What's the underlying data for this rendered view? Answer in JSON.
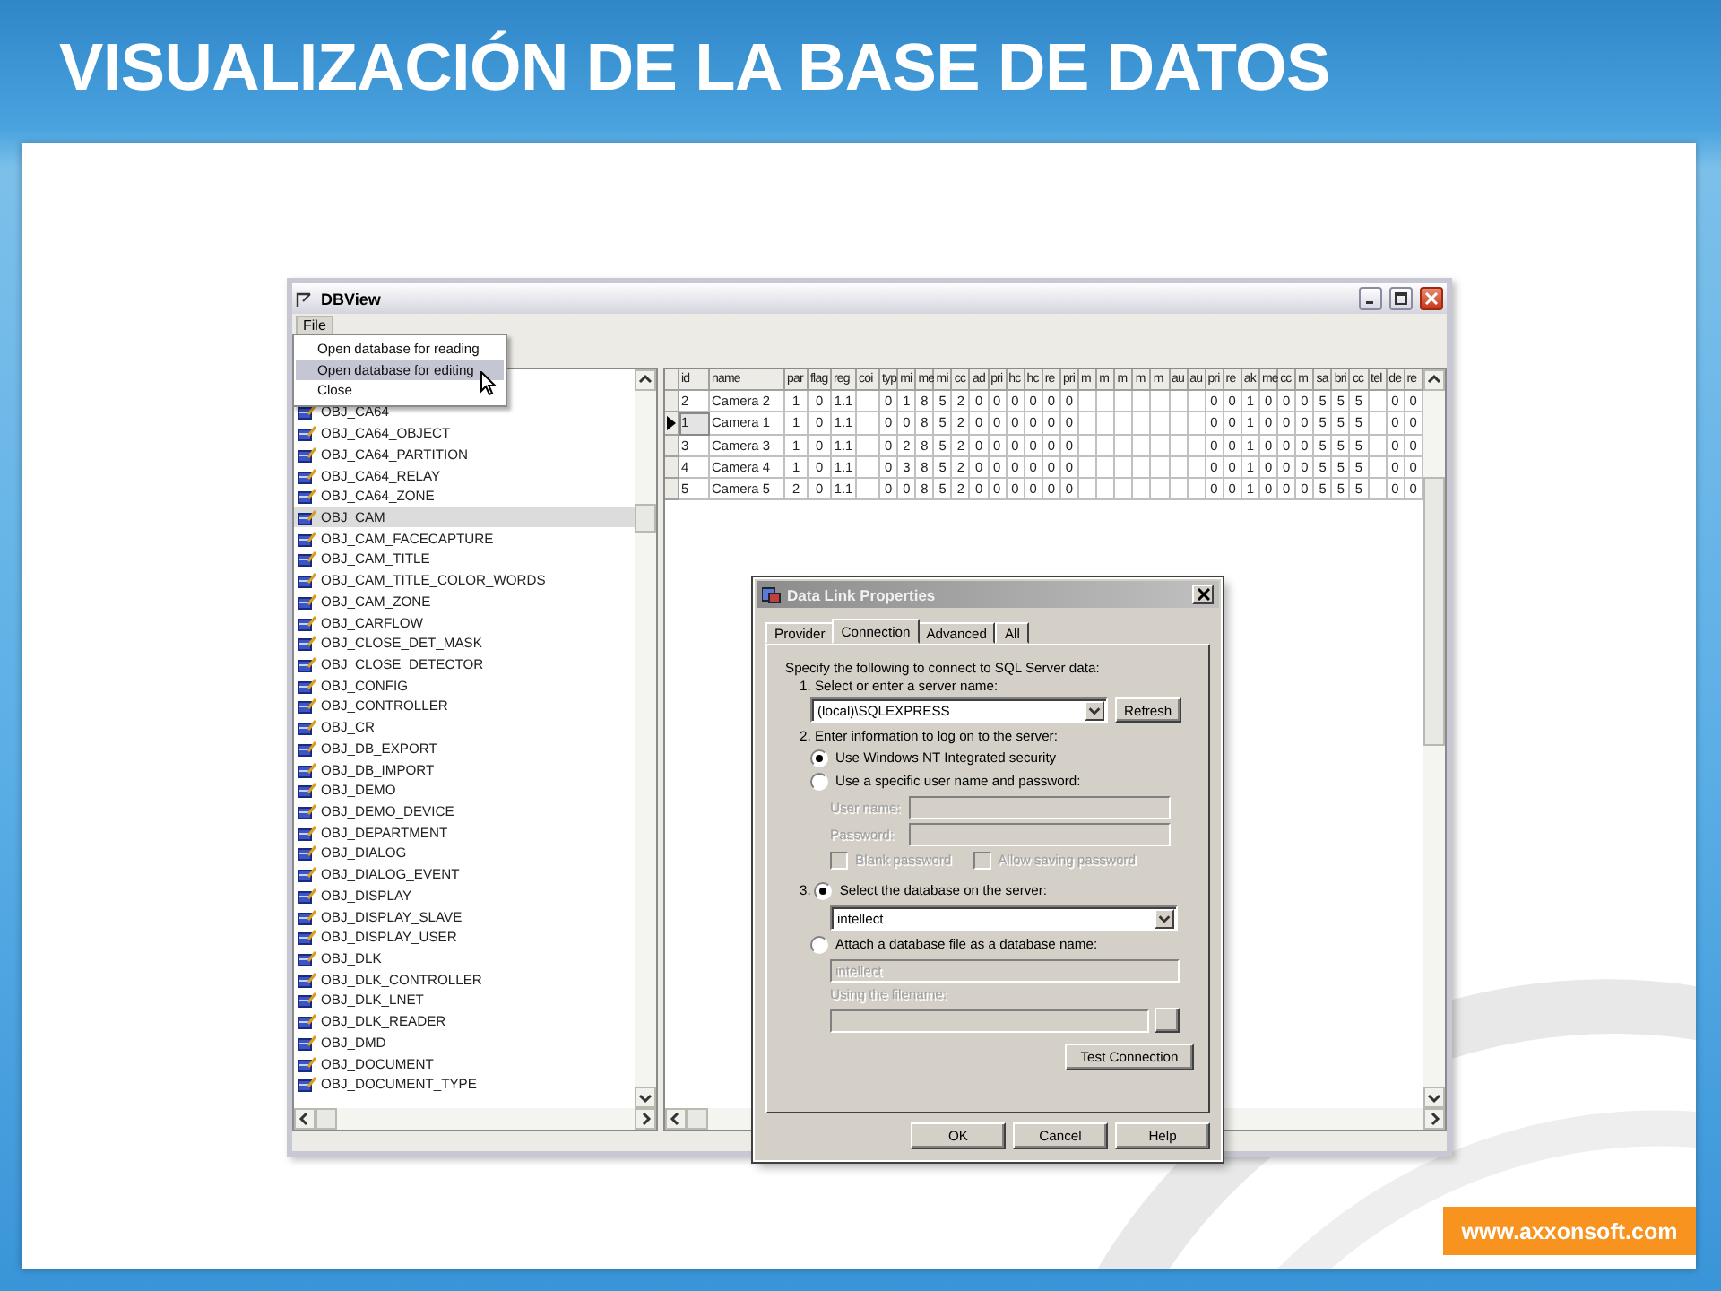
{
  "slide": {
    "title": "VISUALIZACIÓN DE LA BASE DE DATOS",
    "footer_link": "www.axxonsoft.com"
  },
  "dbview": {
    "title": "DBView",
    "menu": [
      "File"
    ],
    "file_menu": [
      {
        "label": "Open database for reading",
        "selected": false
      },
      {
        "label": "Open database for editing",
        "selected": true
      },
      {
        "label": "Close",
        "selected": false
      }
    ],
    "tree": {
      "items": [
        {
          "label": "OBJ_CA64",
          "selected": false
        },
        {
          "label": "OBJ_CA64_OBJECT",
          "selected": false
        },
        {
          "label": "OBJ_CA64_PARTITION",
          "selected": false
        },
        {
          "label": "OBJ_CA64_RELAY",
          "selected": false
        },
        {
          "label": "OBJ_CA64_ZONE",
          "selected": false
        },
        {
          "label": "OBJ_CAM",
          "selected": true
        },
        {
          "label": "OBJ_CAM_FACECAPTURE",
          "selected": false
        },
        {
          "label": "OBJ_CAM_TITLE",
          "selected": false
        },
        {
          "label": "OBJ_CAM_TITLE_COLOR_WORDS",
          "selected": false
        },
        {
          "label": "OBJ_CAM_ZONE",
          "selected": false
        },
        {
          "label": "OBJ_CARFLOW",
          "selected": false
        },
        {
          "label": "OBJ_CLOSE_DET_MASK",
          "selected": false
        },
        {
          "label": "OBJ_CLOSE_DETECTOR",
          "selected": false
        },
        {
          "label": "OBJ_CONFIG",
          "selected": false
        },
        {
          "label": "OBJ_CONTROLLER",
          "selected": false
        },
        {
          "label": "OBJ_CR",
          "selected": false
        },
        {
          "label": "OBJ_DB_EXPORT",
          "selected": false
        },
        {
          "label": "OBJ_DB_IMPORT",
          "selected": false
        },
        {
          "label": "OBJ_DEMO",
          "selected": false
        },
        {
          "label": "OBJ_DEMO_DEVICE",
          "selected": false
        },
        {
          "label": "OBJ_DEPARTMENT",
          "selected": false
        },
        {
          "label": "OBJ_DIALOG",
          "selected": false
        },
        {
          "label": "OBJ_DIALOG_EVENT",
          "selected": false
        },
        {
          "label": "OBJ_DISPLAY",
          "selected": false
        },
        {
          "label": "OBJ_DISPLAY_SLAVE",
          "selected": false
        },
        {
          "label": "OBJ_DISPLAY_USER",
          "selected": false
        },
        {
          "label": "OBJ_DLK",
          "selected": false
        },
        {
          "label": "OBJ_DLK_CONTROLLER",
          "selected": false
        },
        {
          "label": "OBJ_DLK_LNET",
          "selected": false
        },
        {
          "label": "OBJ_DLK_READER",
          "selected": false
        },
        {
          "label": "OBJ_DMD",
          "selected": false
        },
        {
          "label": "OBJ_DOCUMENT",
          "selected": false
        },
        {
          "label": "OBJ_DOCUMENT_TYPE",
          "selected": false
        }
      ]
    },
    "grid": {
      "columns": [
        "id",
        "name",
        "par",
        "flag",
        "reg",
        "coi",
        "typ",
        "mi",
        "me",
        "mi",
        "cc",
        "ad",
        "pri",
        "hc",
        "hc",
        "re",
        "pri",
        "m",
        "m",
        "m",
        "m",
        "m",
        "au",
        "au",
        "pri",
        "re",
        "ak",
        "me",
        "cc",
        "m",
        "sa",
        "bri",
        "cc",
        "tel",
        "de",
        "re"
      ],
      "rows": [
        {
          "current": false,
          "cells": [
            "2",
            "Camera 2",
            "1",
            "0",
            "1.1",
            null,
            "0",
            "1",
            "8",
            "5",
            "2",
            "0",
            "0",
            "0",
            "0",
            "0",
            "0",
            null,
            null,
            null,
            null,
            null,
            null,
            null,
            "0",
            "0",
            "1",
            "0",
            "0",
            "0",
            "5",
            "5",
            "5",
            null,
            "0",
            "0"
          ]
        },
        {
          "current": true,
          "cells": [
            "1",
            "Camera 1",
            "1",
            "0",
            "1.1",
            null,
            "0",
            "0",
            "8",
            "5",
            "2",
            "0",
            "0",
            "0",
            "0",
            "0",
            "0",
            null,
            null,
            null,
            null,
            null,
            null,
            null,
            "0",
            "0",
            "1",
            "0",
            "0",
            "0",
            "5",
            "5",
            "5",
            null,
            "0",
            "0"
          ]
        },
        {
          "current": false,
          "cells": [
            "3",
            "Camera 3",
            "1",
            "0",
            "1.1",
            null,
            "0",
            "2",
            "8",
            "5",
            "2",
            "0",
            "0",
            "0",
            "0",
            "0",
            "0",
            null,
            null,
            null,
            null,
            null,
            null,
            null,
            "0",
            "0",
            "1",
            "0",
            "0",
            "0",
            "5",
            "5",
            "5",
            null,
            "0",
            "0"
          ]
        },
        {
          "current": false,
          "cells": [
            "4",
            "Camera 4",
            "1",
            "0",
            "1.1",
            null,
            "0",
            "3",
            "8",
            "5",
            "2",
            "0",
            "0",
            "0",
            "0",
            "0",
            "0",
            null,
            null,
            null,
            null,
            null,
            null,
            null,
            "0",
            "0",
            "1",
            "0",
            "0",
            "0",
            "5",
            "5",
            "5",
            null,
            "0",
            "0"
          ]
        },
        {
          "current": false,
          "cells": [
            "5",
            "Camera 5",
            "2",
            "0",
            "1.1",
            null,
            "0",
            "0",
            "8",
            "5",
            "2",
            "0",
            "0",
            "0",
            "0",
            "0",
            "0",
            null,
            null,
            null,
            null,
            null,
            null,
            null,
            "0",
            "0",
            "1",
            "0",
            "0",
            "0",
            "5",
            "5",
            "5",
            null,
            "0",
            "0"
          ]
        }
      ]
    }
  },
  "dialog": {
    "title": "Data Link Properties",
    "tabs": [
      {
        "label": "Provider",
        "selected": false
      },
      {
        "label": "Connection",
        "selected": true
      },
      {
        "label": "Advanced",
        "selected": false
      },
      {
        "label": "All",
        "selected": false
      }
    ],
    "intro": "Specify the following to connect to SQL Server data:",
    "step1": {
      "label": "1. Select or enter a server name:",
      "server": "(local)\\SQLEXPRESS",
      "refresh": "Refresh"
    },
    "step2": {
      "label": "2. Enter information to log on to the server:",
      "auth_options": [
        {
          "label": "Use Windows NT Integrated security",
          "selected": true
        },
        {
          "label": "Use a specific user name and password:",
          "selected": false
        }
      ],
      "credentials": {
        "disabled": true,
        "user_name_label": "User name:",
        "password_label": "Password:",
        "options": [
          {
            "label": "Blank password",
            "checked": false
          },
          {
            "label": "Allow saving password",
            "checked": false
          }
        ]
      }
    },
    "step3": {
      "number": "3.",
      "db_options": [
        {
          "label": "Select the database on the server:",
          "selected": true
        },
        {
          "label": "Attach a database file as a database name:",
          "selected": false
        }
      ],
      "database": "intellect",
      "attach": {
        "disabled": true,
        "name": "intellect",
        "filename_label": "Using the filename:"
      },
      "test": "Test Connection"
    },
    "buttons": [
      "OK",
      "Cancel",
      "Help"
    ]
  }
}
